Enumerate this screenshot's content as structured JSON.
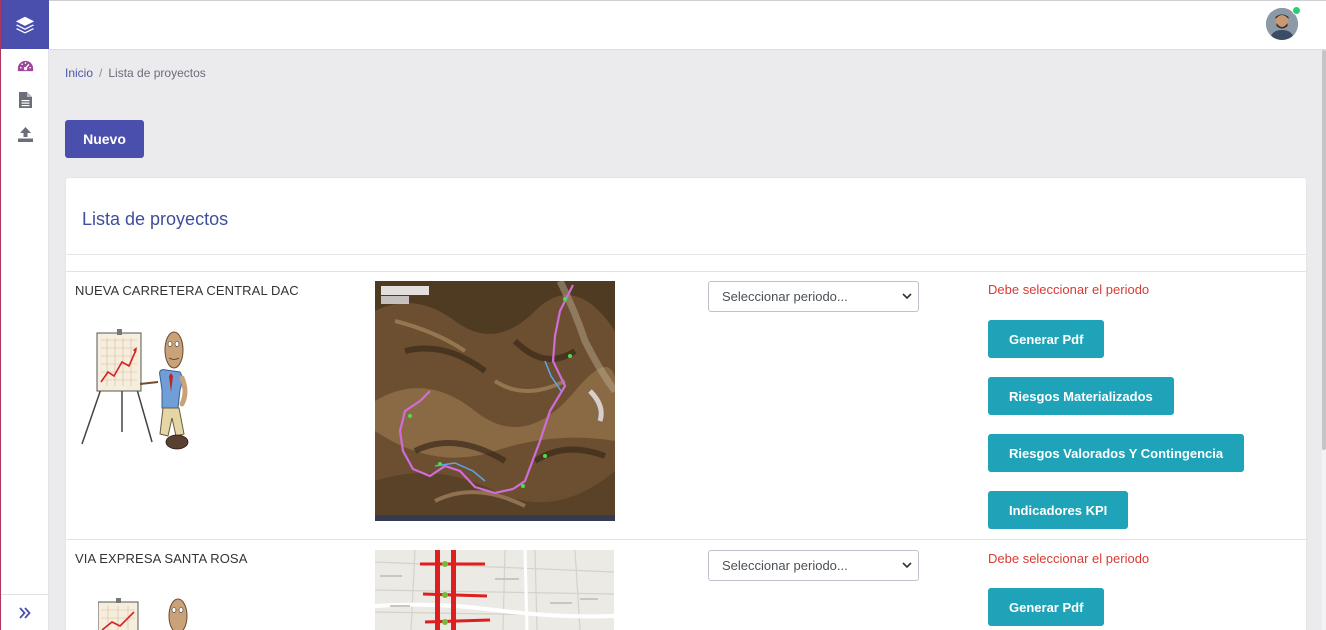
{
  "sidebar": {
    "logo_icon": "layers-icon",
    "items": [
      {
        "icon": "dashboard-gauge-icon",
        "active": true
      },
      {
        "icon": "document-icon",
        "active": false
      },
      {
        "icon": "upload-icon",
        "active": false
      }
    ],
    "footer_icon": "double-chevron-right-icon"
  },
  "topbar": {
    "avatar": "user-avatar",
    "status_color": "#2ecc71"
  },
  "breadcrumb": {
    "home": "Inicio",
    "separator": "/",
    "current": "Lista de proyectos"
  },
  "actions": {
    "new_button": "Nuevo"
  },
  "card": {
    "title": "Lista de proyectos"
  },
  "projects": [
    {
      "name": "NUEVA CARRETERA CENTRAL DAC",
      "period_placeholder": "Seleccionar periodo...",
      "warning": "Debe seleccionar el periodo",
      "buttons": [
        "Generar Pdf",
        "Riesgos Materializados",
        "Riesgos Valorados Y Contingencia",
        "Indicadores KPI"
      ]
    },
    {
      "name": "VIA EXPRESA SANTA ROSA",
      "period_placeholder": "Seleccionar periodo...",
      "warning": "Debe seleccionar el periodo",
      "buttons": [
        "Generar Pdf"
      ]
    }
  ],
  "colors": {
    "primary": "#4a4fae",
    "teal": "#1ea3b8",
    "danger": "#d93a33",
    "title": "#3f4d9c"
  }
}
